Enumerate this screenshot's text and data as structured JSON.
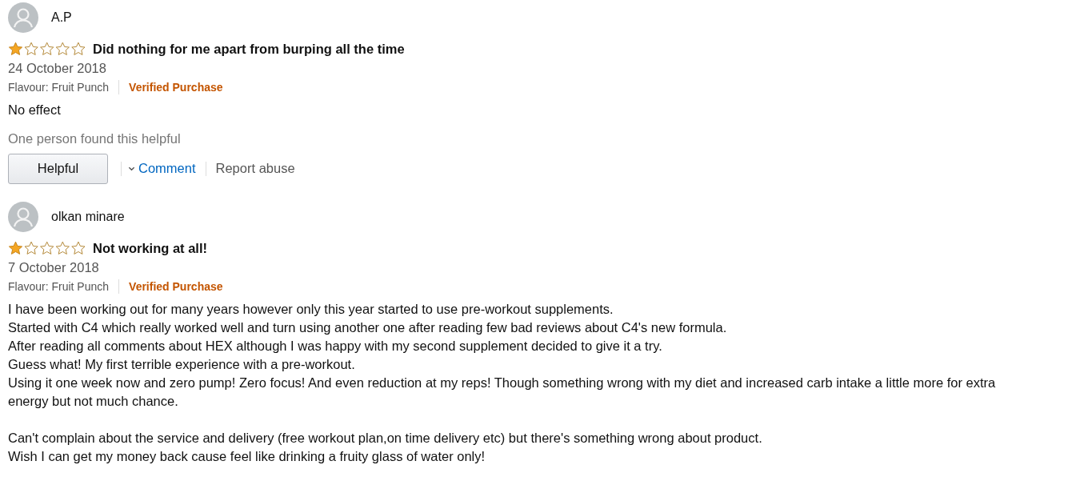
{
  "reviews": [
    {
      "author": "A.P",
      "stars": 1,
      "title": "Did nothing for me apart from burping all the time",
      "date": "24 October 2018",
      "variant": "Flavour: Fruit Punch",
      "badge": "Verified Purchase",
      "paragraphs": [
        [
          "No effect"
        ]
      ],
      "helpful_count": "One person found this helpful",
      "actions": {
        "helpful": "Helpful",
        "comment": "Comment",
        "report": "Report abuse"
      }
    },
    {
      "author": "olkan minare",
      "stars": 1,
      "title": "Not working at all!",
      "date": "7 October 2018",
      "variant": "Flavour: Fruit Punch",
      "badge": "Verified Purchase",
      "paragraphs": [
        [
          "I have been working out for many years however only this year started to use pre-workout supplements.",
          "Started with C4 which really worked well and turn using another one after reading few bad reviews about C4's new formula.",
          "After reading all comments about HEX although I was happy with my second supplement decided to give it a try.",
          "Guess what! My first terrible experience with a pre-workout.",
          "Using it one week now and zero pump! Zero focus! And even reduction at my reps! Though something wrong with my diet and increased carb intake a little more for extra energy but not much chance."
        ],
        [
          "Can't complain about the service and delivery (free workout plan,on time delivery etc) but there's something wrong about product.",
          "Wish I can get my money back cause feel like drinking a fruity glass of water only!"
        ]
      ]
    }
  ]
}
